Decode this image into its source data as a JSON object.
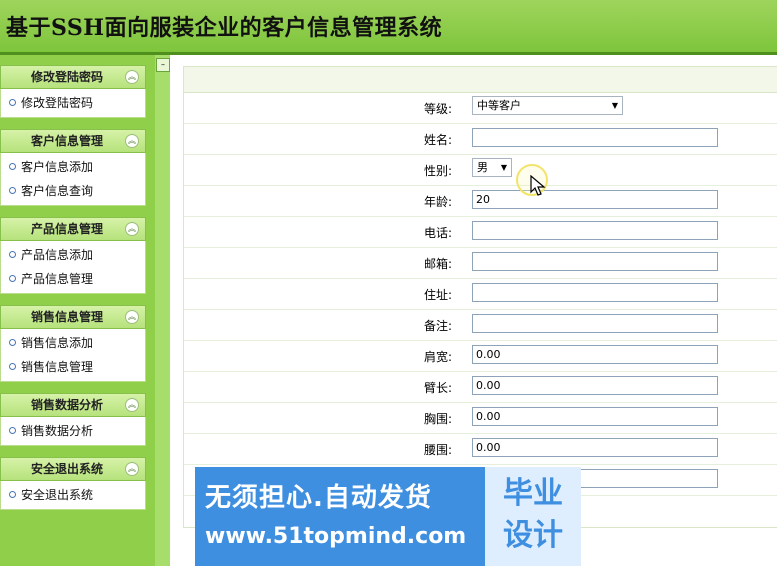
{
  "header": {
    "title": "基于SSH面向服装企业的客户信息管理系统"
  },
  "sidebar": {
    "groups": [
      {
        "title": "修改登陆密码",
        "items": [
          "修改登陆密码"
        ]
      },
      {
        "title": "客户信息管理",
        "items": [
          "客户信息添加",
          "客户信息查询"
        ]
      },
      {
        "title": "产品信息管理",
        "items": [
          "产品信息添加",
          "产品信息管理"
        ]
      },
      {
        "title": "销售信息管理",
        "items": [
          "销售信息添加",
          "销售信息管理"
        ]
      },
      {
        "title": "销售数据分析",
        "items": [
          "销售数据分析"
        ]
      },
      {
        "title": "安全退出系统",
        "items": [
          "安全退出系统"
        ]
      }
    ]
  },
  "form": {
    "level_label": "等级:",
    "level_value": "中等客户",
    "name_label": "姓名:",
    "name_value": "",
    "gender_label": "性别:",
    "gender_value": "男",
    "age_label": "年龄:",
    "age_value": "20",
    "phone_label": "电话:",
    "phone_value": "",
    "email_label": "邮箱:",
    "email_value": "",
    "address_label": "住址:",
    "address_value": "",
    "note_label": "备注:",
    "note_value": "",
    "shoulder_label": "肩宽:",
    "shoulder_value": "0.00",
    "arm_label": "臂长:",
    "arm_value": "0.00",
    "chest_label": "胸围:",
    "chest_value": "0.00",
    "waist_label": "腰围:",
    "waist_value": "0.00",
    "extra_value": ""
  },
  "watermark": {
    "line1": "无须担心.自动发货",
    "line2": "www.51topmind.com",
    "right_line1": "毕业",
    "right_line2": "设计"
  }
}
